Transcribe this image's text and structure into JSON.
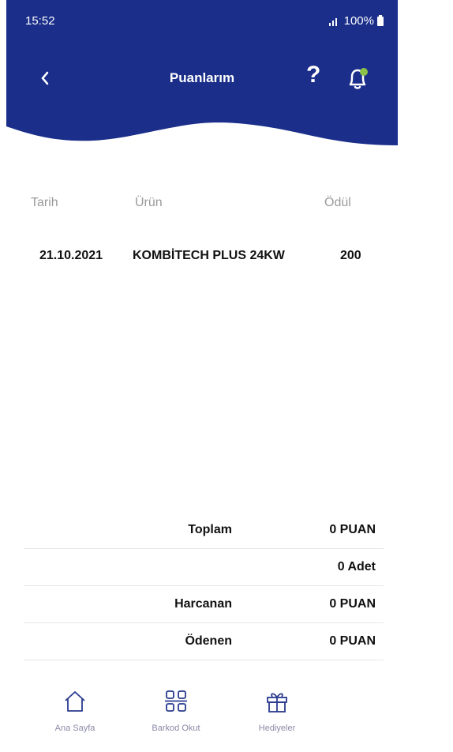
{
  "status_bar": {
    "time": "15:52",
    "battery": "100%"
  },
  "header": {
    "title": "Puanlarım"
  },
  "table": {
    "columns": [
      "Tarih",
      "Ürün",
      "Ödül"
    ],
    "rows": [
      {
        "date": "21.10.2021",
        "product": "KOMBİTECH PLUS 24KW",
        "reward": "200"
      }
    ]
  },
  "summary": [
    {
      "label": "Toplam",
      "value": "0 PUAN"
    },
    {
      "label": "",
      "value": "0 Adet"
    },
    {
      "label": "Harcanan",
      "value": "0 PUAN"
    },
    {
      "label": "Ödenen",
      "value": "0 PUAN"
    }
  ],
  "bottom_nav": [
    {
      "label": "Ana Sayfa",
      "icon": "home-icon"
    },
    {
      "label": "Barkod Okut",
      "icon": "qr-code-icon"
    },
    {
      "label": "Hediyeler",
      "icon": "gift-icon"
    }
  ],
  "colors": {
    "primary": "#1a2e8a",
    "notification_dot": "#8bc34a",
    "nav_icon": "#2a3a8f"
  }
}
